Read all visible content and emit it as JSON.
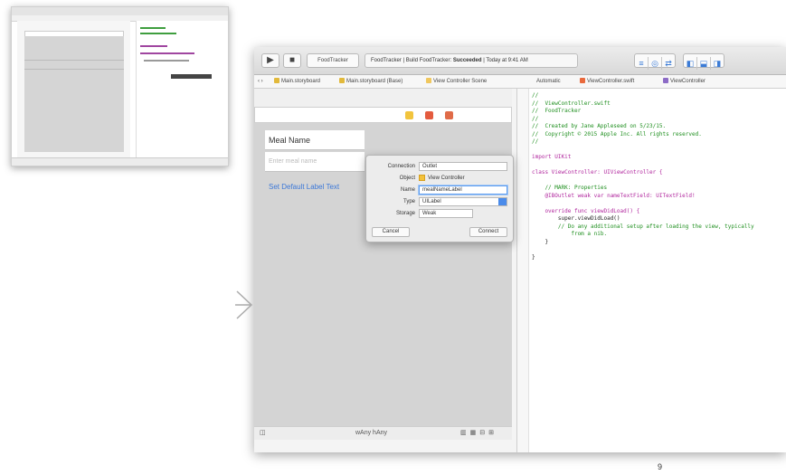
{
  "page": {
    "number": "9"
  },
  "window": {
    "title": "FoodTracker",
    "activity": {
      "project": "FoodTracker",
      "build_prefix": "Build FoodTracker:",
      "build_status": "Succeeded",
      "time": "Today at 9:41 AM"
    },
    "toolbar": {
      "run_icon": "play-icon",
      "stop_icon": "stop-icon",
      "scheme_label": "FoodTracker",
      "device_label": "iPhone 6"
    },
    "jumpbar": {
      "left_path": "Main.storyboard",
      "scene": "Main.storyboard (Base)",
      "controller": "View Controller Scene",
      "right_items": [
        "Automatic",
        "ViewController.swift",
        "ViewController"
      ]
    }
  },
  "storyboard": {
    "scene_title_label": "Meal Name",
    "textfield_placeholder": "Enter meal name",
    "link_label": "Set Default Label Text",
    "size_class": "wAny hAny",
    "scene_dock_icons": [
      "view-controller-icon",
      "first-responder-icon",
      "exit-icon"
    ]
  },
  "connection_popover": {
    "connection_label": "Connection",
    "connection_value": "Outlet",
    "object_label": "Object",
    "object_value": "View Controller",
    "name_label": "Name",
    "name_value": "mealNameLabel",
    "type_label": "Type",
    "type_value": "UILabel",
    "storage_label": "Storage",
    "storage_value": "Weak",
    "cancel_label": "Cancel",
    "connect_label": "Connect"
  },
  "code": {
    "lines": [
      {
        "cls": "c-com",
        "text": "//"
      },
      {
        "cls": "c-com",
        "text": "//  ViewController.swift"
      },
      {
        "cls": "c-com",
        "text": "//  FoodTracker"
      },
      {
        "cls": "c-com",
        "text": "//"
      },
      {
        "cls": "c-com",
        "text": "//  Created by Jane Appleseed on 5/23/15."
      },
      {
        "cls": "c-com",
        "text": "//  Copyright © 2015 Apple Inc. All rights reserved."
      },
      {
        "cls": "c-com",
        "text": "//"
      },
      {
        "cls": "c-txt",
        "text": ""
      },
      {
        "cls": "c-kw",
        "text": "import UIKit"
      },
      {
        "cls": "c-txt",
        "text": ""
      },
      {
        "cls": "c-kw",
        "text": "class ViewController: UIViewController {"
      },
      {
        "cls": "c-txt",
        "text": ""
      },
      {
        "cls": "c-com",
        "text": "    // MARK: Properties"
      },
      {
        "cls": "c-kw",
        "text": "    @IBOutlet weak var nameTextField: UITextField!"
      },
      {
        "cls": "c-txt",
        "text": ""
      },
      {
        "cls": "c-kw",
        "text": "    override func viewDidLoad() {"
      },
      {
        "cls": "c-txt",
        "text": "        super.viewDidLoad()"
      },
      {
        "cls": "c-com",
        "text": "        // Do any additional setup after loading the view, typically"
      },
      {
        "cls": "c-com",
        "text": "            from a nib."
      },
      {
        "cls": "c-txt",
        "text": "    }"
      },
      {
        "cls": "c-txt",
        "text": ""
      },
      {
        "cls": "c-txt",
        "text": "}"
      }
    ]
  }
}
